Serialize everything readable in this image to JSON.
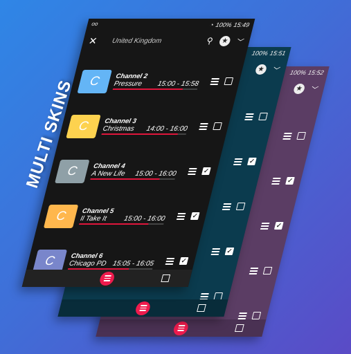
{
  "headline": "MULTI SKINS",
  "colors": {
    "dark": "#161616",
    "teal": "#0b3b4e",
    "purple": "#5b3d64",
    "accent": "#e0163c"
  },
  "skins": [
    {
      "name": "purple",
      "time": "15:52",
      "battery": "100%",
      "rows_checked": [
        false,
        true,
        true,
        false,
        false
      ]
    },
    {
      "name": "teal",
      "time": "15:51",
      "battery": "100%",
      "rows_checked": [
        false,
        true,
        false,
        true,
        false
      ]
    }
  ],
  "front": {
    "time": "15:49",
    "battery": "100%",
    "title": "United Kingdom",
    "icons": [
      "close-icon",
      "search-icon",
      "star-icon",
      "chevron-down-icon"
    ],
    "channels": [
      {
        "logo": "C",
        "color": "#64b5f6",
        "name": "Channel 2",
        "program": "Pressure",
        "time": "15:00 - 15:58",
        "progress": 83,
        "checked": false
      },
      {
        "logo": "C",
        "color": "#fdd24f",
        "name": "Channel 3",
        "program": "Christmas",
        "time": "14:00 - 16:00",
        "progress": 90,
        "checked": false
      },
      {
        "logo": "C",
        "color": "#8fa0a7",
        "name": "Channel 4",
        "program": "A New Life",
        "time": "15:00 - 16:00",
        "progress": 82,
        "checked": true
      },
      {
        "logo": "C",
        "color": "#ffb74d",
        "name": "Channel 5",
        "program": "Il Take It",
        "time": "15:00 - 16:00",
        "progress": 82,
        "checked": true
      },
      {
        "logo": "C",
        "color": "#7986cb",
        "name": "Channel 6",
        "program": "Chicago PD",
        "time": "15:05 - 16:05",
        "progress": 72,
        "checked": true
      }
    ]
  }
}
